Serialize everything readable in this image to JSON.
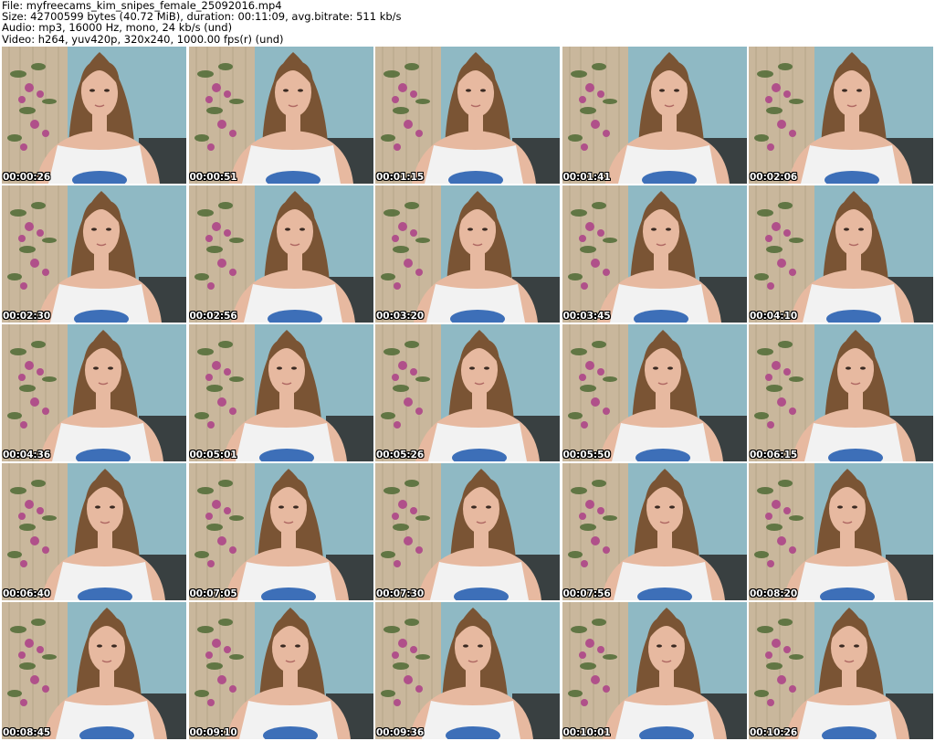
{
  "header": {
    "file": "File: myfreecams_kim_snipes_female_25092016.mp4",
    "size": "Size: 42700599 bytes (40.72 MiB), duration: 00:11:09, avg.bitrate: 511 kb/s",
    "audio": "Audio: mp3, 16000 Hz, mono, 24 kb/s (und)",
    "video": "Video: h264, yuv420p, 320x240, 1000.00 fps(r) (und)"
  },
  "thumbnails": [
    {
      "time": "00:00:26"
    },
    {
      "time": "00:00:51"
    },
    {
      "time": "00:01:15"
    },
    {
      "time": "00:01:41"
    },
    {
      "time": "00:02:06"
    },
    {
      "time": "00:02:30"
    },
    {
      "time": "00:02:56"
    },
    {
      "time": "00:03:20"
    },
    {
      "time": "00:03:45"
    },
    {
      "time": "00:04:10"
    },
    {
      "time": "00:04:36"
    },
    {
      "time": "00:05:01"
    },
    {
      "time": "00:05:26"
    },
    {
      "time": "00:05:50"
    },
    {
      "time": "00:06:15"
    },
    {
      "time": "00:06:40"
    },
    {
      "time": "00:07:05"
    },
    {
      "time": "00:07:30"
    },
    {
      "time": "00:07:56"
    },
    {
      "time": "00:08:20"
    },
    {
      "time": "00:08:45"
    },
    {
      "time": "00:09:10"
    },
    {
      "time": "00:09:36"
    },
    {
      "time": "00:10:01"
    },
    {
      "time": "00:10:26"
    }
  ],
  "colors": {
    "wall": "#8fb9c4",
    "curtain": "#c9b79c",
    "flowers": "#b0508a",
    "leaves": "#4f6b35",
    "hair": "#7a5434",
    "skin": "#e7b9a0",
    "shirt": "#f2f2f2",
    "shirt_print": "#3d6fb8",
    "timestamp_text": "#ffffff"
  }
}
